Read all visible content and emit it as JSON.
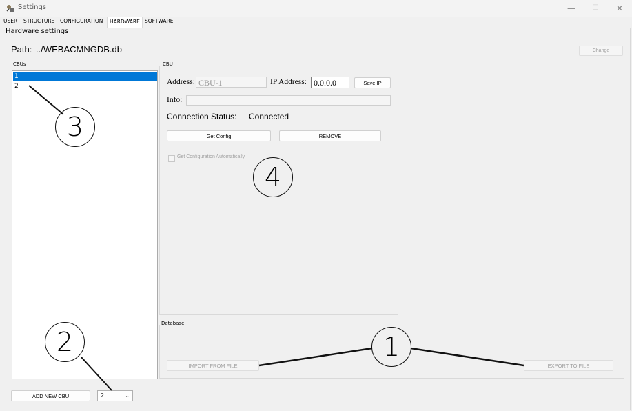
{
  "window": {
    "title": "Settings",
    "minimize_glyph": "—",
    "maximize_glyph": "☐",
    "close_glyph": "✕"
  },
  "tabs": [
    {
      "label": "USER"
    },
    {
      "label": "STRUCTURE"
    },
    {
      "label": "CONFIGURATION"
    },
    {
      "label": "HARDWARE",
      "active": true
    },
    {
      "label": "SOFTWARE"
    }
  ],
  "hardware": {
    "section_title": "Hardware settings",
    "path_label": "Path:",
    "path_value": "../WEBACMNGDB.db",
    "change_button": "Change"
  },
  "cbus": {
    "group_label": "CBUs",
    "items": [
      "1",
      "2"
    ],
    "selected_index": 0,
    "add_button": "ADD NEW CBU",
    "count_select_value": "2"
  },
  "cbu": {
    "group_label": "CBU",
    "address_label": "Address:",
    "address_value": "CBU-1",
    "ip_label": "IP Address:",
    "ip_value": "0.0.0.0",
    "save_ip_button": "Save IP",
    "info_label": "Info:",
    "info_value": "",
    "connection_label": "Connection Status:",
    "connection_value": "Connected",
    "get_config_button": "Get Config",
    "remove_button": "REMOVE",
    "auto_config_label": "Get Configuration Automatically"
  },
  "database": {
    "group_label": "Database",
    "import_button": "IMPORT FROM FILE",
    "export_button": "EXPORT TO FILE"
  },
  "callouts": [
    "1",
    "2",
    "3",
    "4"
  ]
}
